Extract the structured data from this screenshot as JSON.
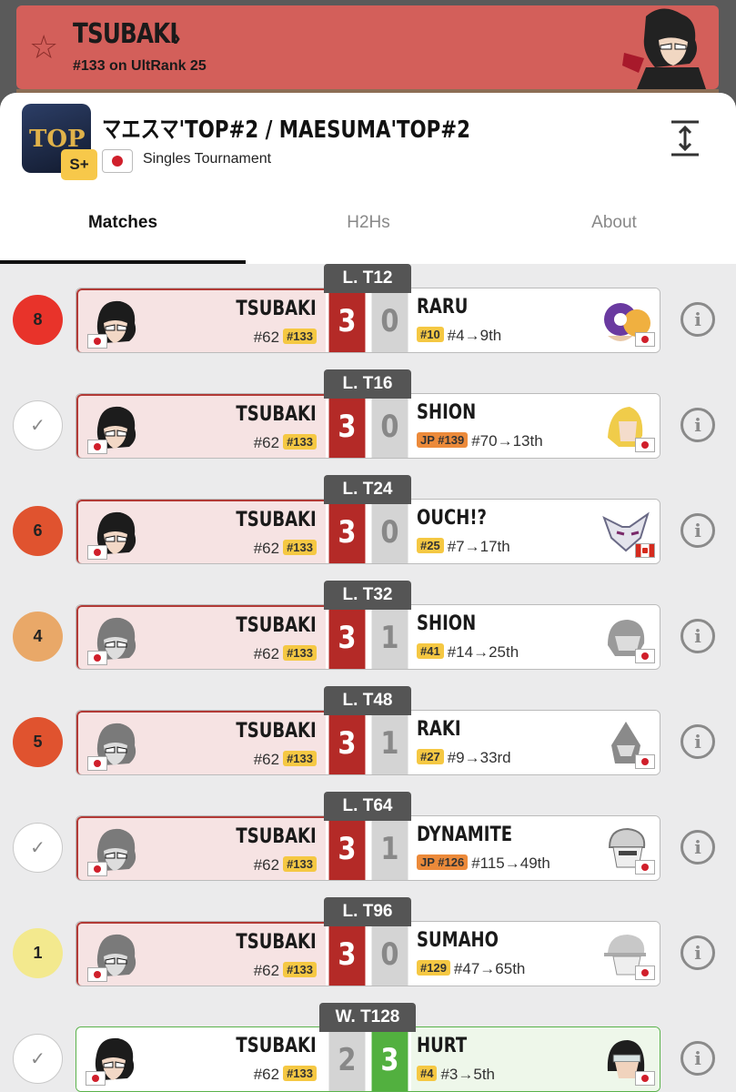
{
  "player": {
    "name": "TSUBAKI",
    "rank_text": "#133 on UltRank 25",
    "accent": "#d35f5a"
  },
  "tournament": {
    "title": "マエスマ'TOP#2 / MAESUMA'TOP#2",
    "tier": "S+",
    "type": "Singles Tournament",
    "logo_text": "TOP"
  },
  "tabs": [
    "Matches",
    "H2Hs",
    "About"
  ],
  "matches": [
    {
      "round": "L. T12",
      "circle": "8",
      "circle_color": "#e8332a",
      "p1": {
        "name": "TSUBAKI",
        "rank": "#62",
        "badge": "#133"
      },
      "s1": "3",
      "s2": "0",
      "p2": {
        "name": "RARU",
        "badge": "#10",
        "badge_type": "std",
        "seed": "#4→9th"
      }
    },
    {
      "round": "L. T16",
      "circle": "✓",
      "circle_color": "",
      "p1": {
        "name": "TSUBAKI",
        "rank": "#62",
        "badge": "#133"
      },
      "s1": "3",
      "s2": "0",
      "p2": {
        "name": "SHION",
        "badge": "JP #139",
        "badge_type": "jp",
        "seed": "#70→13th"
      }
    },
    {
      "round": "L. T24",
      "circle": "6",
      "circle_color": "#e0532f",
      "p1": {
        "name": "TSUBAKI",
        "rank": "#62",
        "badge": "#133"
      },
      "s1": "3",
      "s2": "0",
      "p2": {
        "name": "OUCH!?",
        "badge": "#25",
        "badge_type": "std",
        "seed": "#7→17th"
      }
    },
    {
      "round": "L. T32",
      "circle": "4",
      "circle_color": "#e9a868",
      "p1": {
        "name": "TSUBAKI",
        "rank": "#62",
        "badge": "#133"
      },
      "s1": "3",
      "s2": "1",
      "p2": {
        "name": "SHION",
        "badge": "#41",
        "badge_type": "std",
        "seed": "#14→25th"
      }
    },
    {
      "round": "L. T48",
      "circle": "5",
      "circle_color": "#e0532f",
      "p1": {
        "name": "TSUBAKI",
        "rank": "#62",
        "badge": "#133"
      },
      "s1": "3",
      "s2": "1",
      "p2": {
        "name": "RAKI",
        "badge": "#27",
        "badge_type": "std",
        "seed": "#9→33rd"
      }
    },
    {
      "round": "L. T64",
      "circle": "✓",
      "circle_color": "",
      "p1": {
        "name": "TSUBAKI",
        "rank": "#62",
        "badge": "#133"
      },
      "s1": "3",
      "s2": "1",
      "p2": {
        "name": "DYNAMITE",
        "badge": "JP #126",
        "badge_type": "jp",
        "seed": "#115→49th"
      }
    },
    {
      "round": "L. T96",
      "circle": "1",
      "circle_color": "#f3e98e",
      "p1": {
        "name": "TSUBAKI",
        "rank": "#62",
        "badge": "#133"
      },
      "s1": "3",
      "s2": "0",
      "p2": {
        "name": "SUMAHO",
        "badge": "#129",
        "badge_type": "std",
        "seed": "#47→65th"
      }
    },
    {
      "round": "W. T128",
      "circle": "✓",
      "circle_color": "",
      "p1": {
        "name": "TSUBAKI",
        "rank": "#62",
        "badge": "#133"
      },
      "s1": "2",
      "s2": "3",
      "p2": {
        "name": "HURT",
        "badge": "#4",
        "badge_type": "std",
        "seed": "#3→5th"
      }
    }
  ]
}
